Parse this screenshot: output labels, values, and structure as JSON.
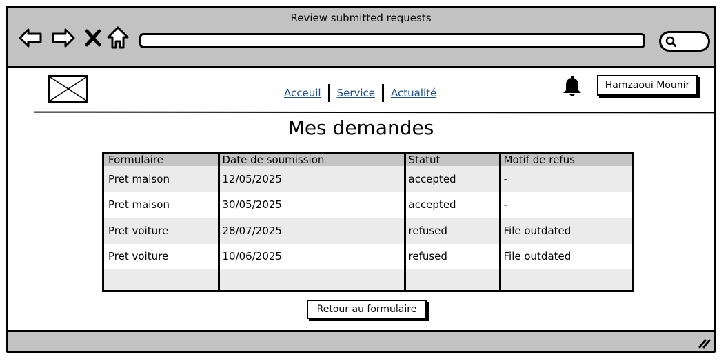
{
  "window": {
    "title": "Review submitted requests"
  },
  "browser": {
    "icons": [
      "back-arrow-icon",
      "forward-arrow-icon",
      "close-x-icon",
      "home-icon",
      "search-icon"
    ],
    "address_value": ""
  },
  "header": {
    "logo_icon": "image-placeholder-icon",
    "nav": [
      {
        "label": "Acceuil"
      },
      {
        "label": "Service"
      },
      {
        "label": "Actualité"
      }
    ],
    "notification_icon": "bell-icon",
    "user_name": "Hamzaoui Mounir"
  },
  "main": {
    "title": "Mes demandes",
    "table": {
      "columns": [
        "Formulaire",
        "Date de soumission",
        "Statut",
        "Motif de refus"
      ],
      "rows": [
        [
          "Pret maison",
          "12/05/2025",
          "accepted",
          "-"
        ],
        [
          "Pret maison",
          "30/05/2025",
          "accepted",
          "-"
        ],
        [
          "Pret voiture",
          "28/07/2025",
          "refused",
          "File outdated"
        ],
        [
          "Pret voiture",
          "10/06/2025",
          "refused",
          "File outdated"
        ],
        [
          "",
          "",
          "",
          ""
        ]
      ]
    },
    "return_button": "Retour au formulaire"
  },
  "colors": {
    "chrome_gray": "#c2c2c2",
    "link_blue": "#1b4f8a",
    "header_row_gray": "#c4c4c4",
    "alt_row_gray": "#ebebeb"
  }
}
